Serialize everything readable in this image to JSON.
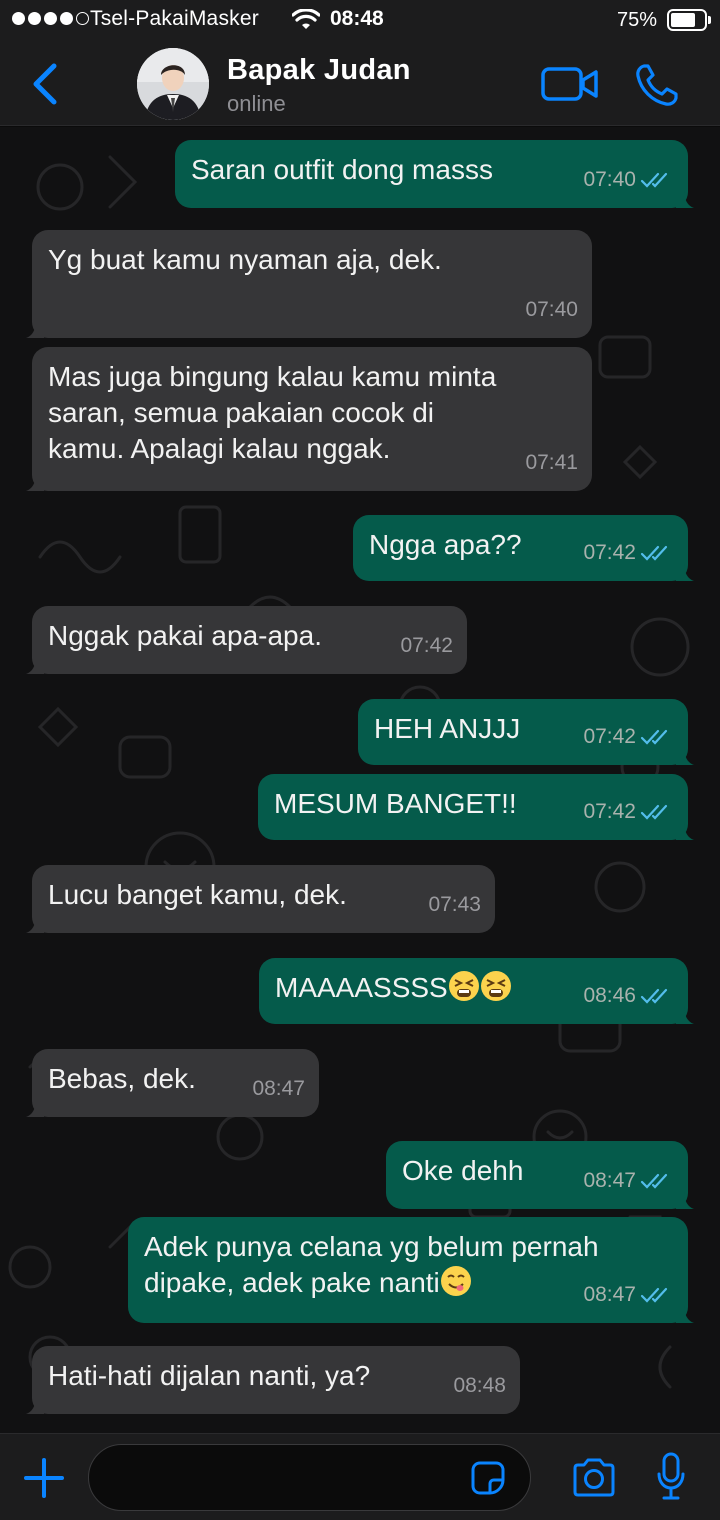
{
  "status_bar": {
    "carrier": "Tsel-PakaiMasker",
    "time": "08:48",
    "battery_percent": "75%",
    "battery_level": 0.75,
    "signal_bars_filled": 4,
    "signal_bars_total": 5
  },
  "header": {
    "contact_name": "Bapak Judan",
    "contact_status": "online",
    "icons": [
      "back-chevron-icon",
      "video-call-icon",
      "voice-call-icon"
    ]
  },
  "messages": [
    {
      "dir": "out",
      "text": "Saran outfit dong masss",
      "time": "07:40",
      "read": true
    },
    {
      "dir": "in",
      "text": "Yg buat kamu nyaman aja, dek.",
      "time": "07:40"
    },
    {
      "dir": "in",
      "lines": [
        "Mas juga bingung kalau kamu minta",
        "saran, semua pakaian cocok di",
        "kamu. Apalagi kalau nggak."
      ],
      "time": "07:41"
    },
    {
      "dir": "out",
      "text": "Ngga apa??",
      "time": "07:42",
      "read": true
    },
    {
      "dir": "in",
      "text": "Nggak pakai apa-apa.",
      "time": "07:42"
    },
    {
      "dir": "out",
      "text": "HEH ANJJJ",
      "time": "07:42",
      "read": true
    },
    {
      "dir": "out",
      "text": "MESUM BANGET!!",
      "time": "07:42",
      "read": true
    },
    {
      "dir": "in",
      "text": "Lucu banget kamu, dek.",
      "time": "07:43"
    },
    {
      "dir": "out",
      "text": "MAAAASSSS",
      "emoji": "tired-face-emoji x2",
      "time": "08:46",
      "read": true
    },
    {
      "dir": "in",
      "text": "Bebas, dek.",
      "time": "08:47"
    },
    {
      "dir": "out",
      "text": "Oke dehh",
      "time": "08:47",
      "read": true
    },
    {
      "dir": "out",
      "lines": [
        "Adek punya celana yg belum pernah",
        "dipake, adek pake nanti"
      ],
      "emoji": "yum-face-emoji",
      "time": "08:47",
      "read": true
    },
    {
      "dir": "in",
      "text": "Hati-hati dijalan nanti, ya?",
      "time": "08:48"
    }
  ],
  "input_bar": {
    "placeholder": "",
    "icons": [
      "plus-icon",
      "sticker-icon",
      "camera-icon",
      "microphone-icon"
    ]
  },
  "colors": {
    "accent": "#0a84ff",
    "outgoing_bubble": "#055b4b",
    "incoming_bubble": "#363638",
    "read_tick": "#53bdeb",
    "bar_background": "#1c1c1d"
  }
}
